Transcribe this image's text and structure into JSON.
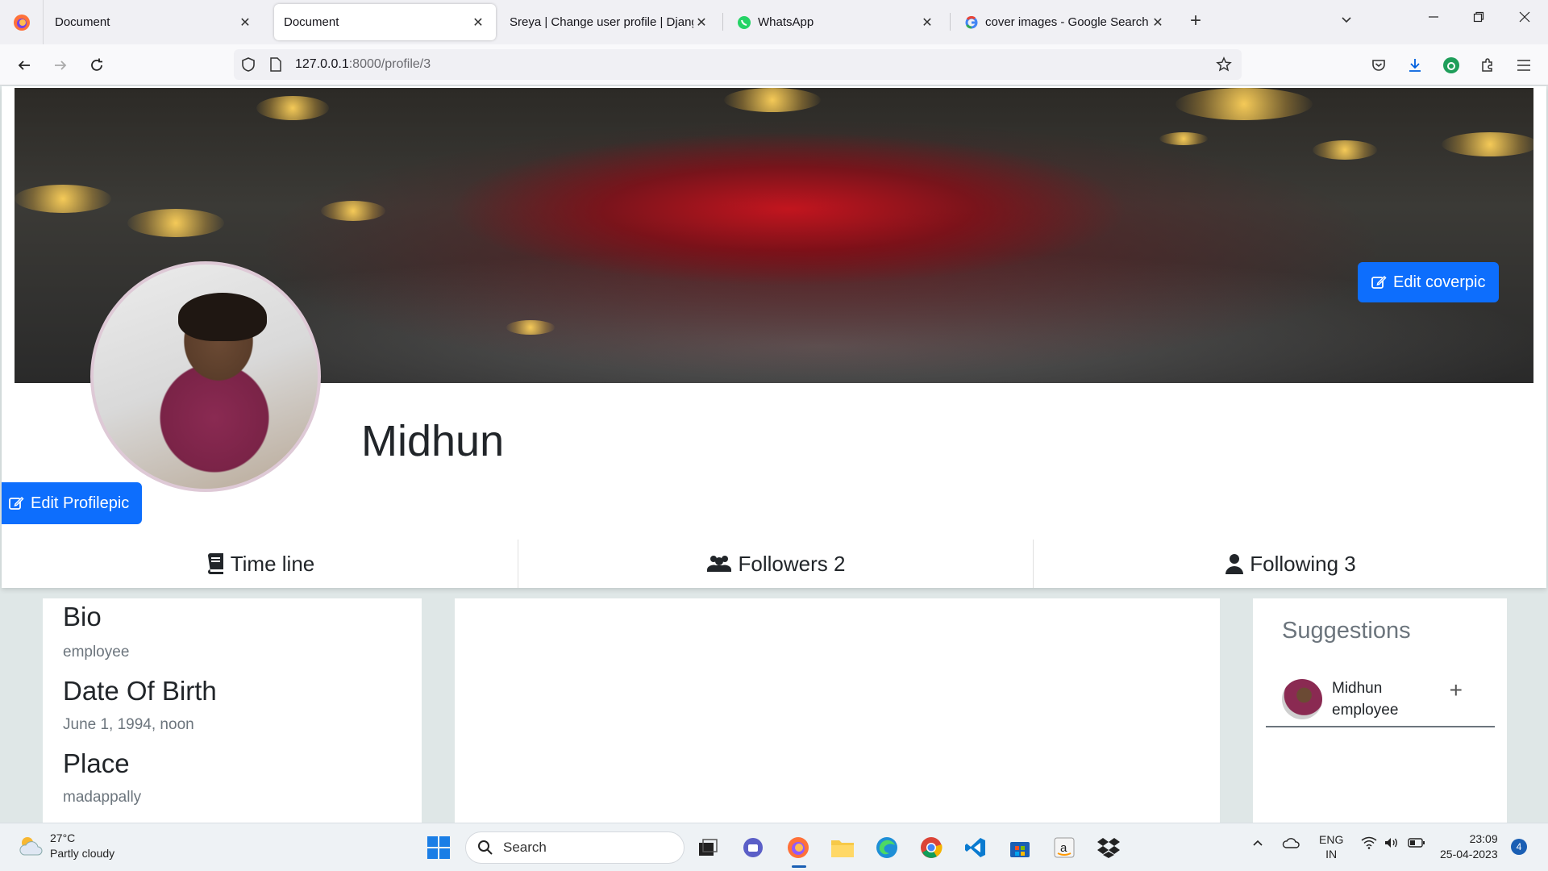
{
  "browser": {
    "tabs": [
      {
        "label": "Document",
        "active": false
      },
      {
        "label": "Document",
        "active": true
      },
      {
        "label": "Sreya | Change user profile | Django",
        "active": false
      },
      {
        "label": "WhatsApp",
        "active": false
      },
      {
        "label": "cover images - Google Search",
        "active": false
      }
    ],
    "close_glyph": "✕",
    "new_tab_glyph": "+",
    "url_host": "127.0.0.1",
    "url_rest": ":8000/profile/3"
  },
  "profile": {
    "edit_cover_label": "Edit coverpic",
    "edit_profile_label": "Edit Profilepic",
    "name": "Midhun",
    "tabs": [
      {
        "label": "Time line",
        "icon": "book-icon"
      },
      {
        "label": "Followers 2",
        "icon": "users-icon"
      },
      {
        "label": "Following 3",
        "icon": "user-icon"
      }
    ]
  },
  "bio": {
    "bio_heading": "Bio",
    "bio_value": "employee",
    "dob_heading": "Date Of Birth",
    "dob_value": "June 1, 1994, noon",
    "place_heading": "Place",
    "place_value": "madappally"
  },
  "suggestions": {
    "title": "Suggestions",
    "items": [
      {
        "name": "Midhun",
        "role": "employee",
        "add_glyph": "+"
      }
    ]
  },
  "taskbar": {
    "weather_temp": "27°C",
    "weather_desc": "Partly cloudy",
    "search_label": "Search",
    "lang_line1": "ENG",
    "lang_line2": "IN",
    "time": "23:09",
    "date": "25-04-2023",
    "notification_count": "4"
  }
}
